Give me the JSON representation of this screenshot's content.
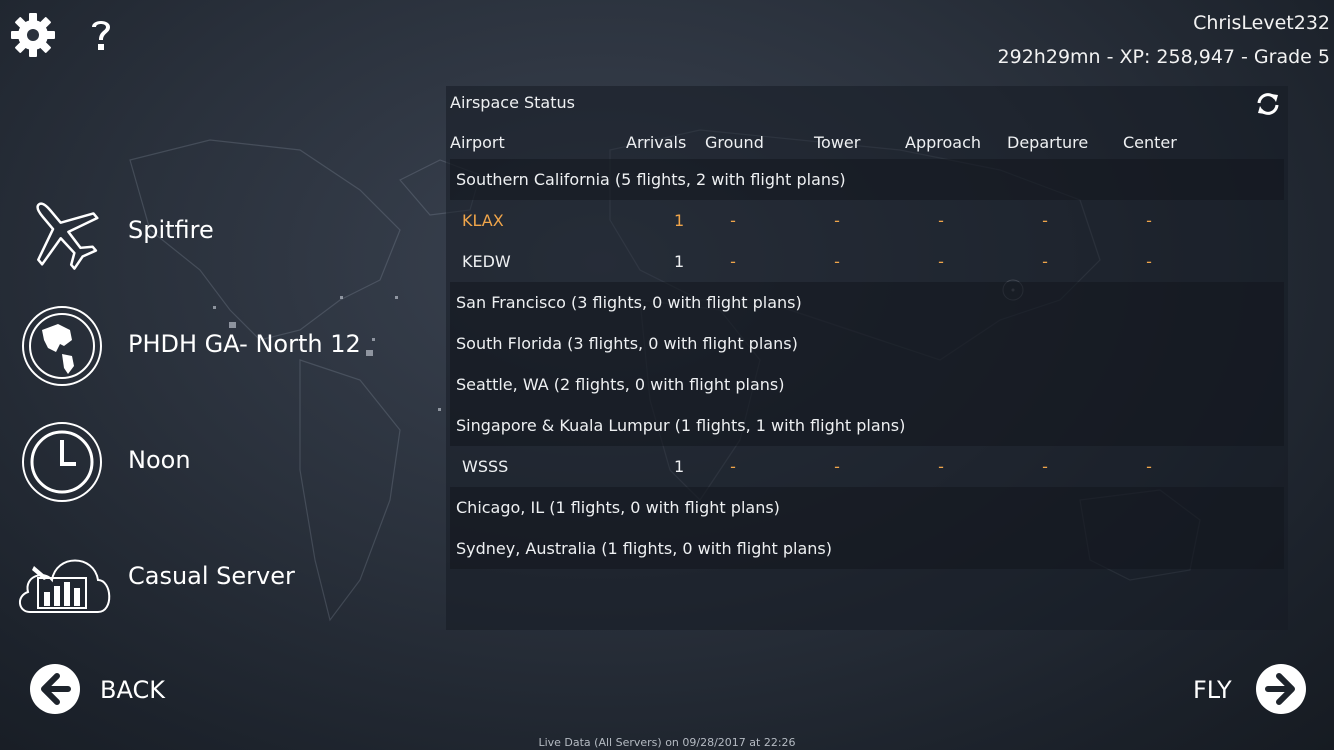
{
  "header": {
    "settings_icon": "gear-icon",
    "help_icon": "question-icon",
    "username": "ChrisLevet232",
    "stats": "292h29mn - XP: 258,947 - Grade 5"
  },
  "sidebar": {
    "items": [
      {
        "label": "Spitfire",
        "icon": "airplane-icon"
      },
      {
        "label": "PHDH GA- North 12",
        "icon": "globe-icon"
      },
      {
        "label": "Noon",
        "icon": "clock-icon"
      },
      {
        "label": "Casual Server",
        "icon": "cloud-server-icon"
      }
    ]
  },
  "panel": {
    "title": "Airspace Status",
    "columns": [
      "Airport",
      "Arrivals",
      "Ground",
      "Tower",
      "Approach",
      "Departure",
      "Center"
    ],
    "regions": [
      {
        "label": "Southern California (5 flights, 2 with flight plans)",
        "airports": [
          {
            "code": "KLAX",
            "arrivals": "1",
            "ground": "-",
            "tower": "-",
            "approach": "-",
            "departure": "-",
            "center": "-",
            "highlight": true
          },
          {
            "code": "KEDW",
            "arrivals": "1",
            "ground": "-",
            "tower": "-",
            "approach": "-",
            "departure": "-",
            "center": "-",
            "highlight": false
          }
        ]
      },
      {
        "label": "San Francisco (3 flights, 0 with flight plans)",
        "airports": []
      },
      {
        "label": "South Florida (3 flights, 0 with flight plans)",
        "airports": []
      },
      {
        "label": "Seattle, WA (2 flights, 0 with flight plans)",
        "airports": []
      },
      {
        "label": "Singapore & Kuala Lumpur (1 flights, 1 with flight plans)",
        "airports": [
          {
            "code": "WSSS",
            "arrivals": "1",
            "ground": "-",
            "tower": "-",
            "approach": "-",
            "departure": "-",
            "center": "-",
            "highlight": false
          }
        ]
      },
      {
        "label": "Chicago, IL (1 flights, 0 with flight plans)",
        "airports": []
      },
      {
        "label": "Sydney, Australia (1 flights, 0 with flight plans)",
        "airports": []
      }
    ]
  },
  "nav": {
    "back_label": "BACK",
    "fly_label": "FLY"
  },
  "footer": {
    "text": "Live Data (All Servers) on 09/28/2017 at 22:26"
  },
  "colors": {
    "accent": "#f0a54a",
    "text": "#eef0f2"
  }
}
